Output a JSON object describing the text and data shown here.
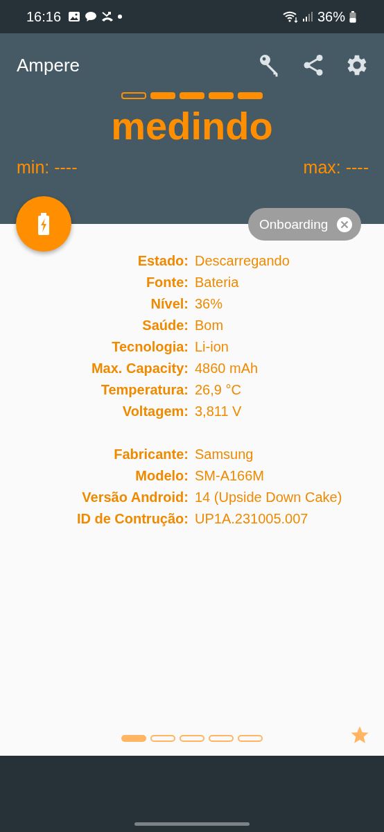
{
  "status_bar": {
    "time": "16:16",
    "battery": "36%"
  },
  "app_bar": {
    "title": "Ampere"
  },
  "meter": {
    "segments": [
      {
        "filled": false
      },
      {
        "filled": true
      },
      {
        "filled": true
      },
      {
        "filled": true
      },
      {
        "filled": true
      }
    ],
    "reading": "medindo",
    "min": "min: ----",
    "max": "max: ----"
  },
  "onboarding_chip": {
    "label": "Onboarding"
  },
  "info_groups": [
    [
      {
        "label": "Estado:",
        "value": "Descarregando"
      },
      {
        "label": "Fonte:",
        "value": "Bateria"
      },
      {
        "label": "Nível:",
        "value": "36%"
      },
      {
        "label": "Saúde:",
        "value": "Bom"
      },
      {
        "label": "Tecnologia:",
        "value": "Li-ion"
      },
      {
        "label": "Max. Capacity:",
        "value": "4860 mAh"
      },
      {
        "label": "Temperatura:",
        "value": "26,9 °C"
      },
      {
        "label": "Voltagem:",
        "value": "3,811 V"
      }
    ],
    [
      {
        "label": "Fabricante:",
        "value": "Samsung"
      },
      {
        "label": "Modelo:",
        "value": "SM-A166M"
      },
      {
        "label": "Versão Android:",
        "value": "14 (Upside Down Cake)"
      },
      {
        "label": "ID de Contrução:",
        "value": "UP1A.231005.007"
      }
    ]
  ],
  "pages": [
    {
      "selected": true
    },
    {
      "selected": false
    },
    {
      "selected": false
    },
    {
      "selected": false
    },
    {
      "selected": false
    }
  ]
}
